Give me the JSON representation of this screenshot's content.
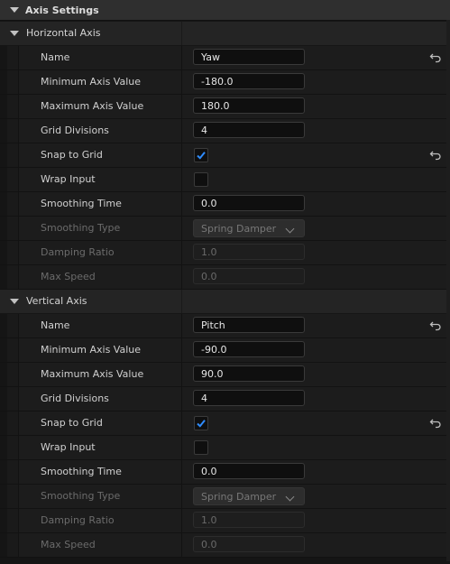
{
  "category": {
    "title": "Axis Settings"
  },
  "sections": [
    {
      "title": "Horizontal Axis",
      "rows": [
        {
          "label": "Name",
          "type": "text",
          "value": "Yaw",
          "reset": true,
          "disabled": false
        },
        {
          "label": "Minimum Axis Value",
          "type": "text",
          "value": "-180.0",
          "reset": false,
          "disabled": false
        },
        {
          "label": "Maximum Axis Value",
          "type": "text",
          "value": "180.0",
          "reset": false,
          "disabled": false
        },
        {
          "label": "Grid Divisions",
          "type": "text",
          "value": "4",
          "reset": false,
          "disabled": false
        },
        {
          "label": "Snap to Grid",
          "type": "checkbox",
          "checked": true,
          "reset": true,
          "disabled": false
        },
        {
          "label": "Wrap Input",
          "type": "checkbox",
          "checked": false,
          "reset": false,
          "disabled": false
        },
        {
          "label": "Smoothing Time",
          "type": "text",
          "value": "0.0",
          "reset": false,
          "disabled": false
        },
        {
          "label": "Smoothing Type",
          "type": "dropdown",
          "value": "Spring Damper",
          "reset": false,
          "disabled": true
        },
        {
          "label": "Damping Ratio",
          "type": "text",
          "value": "1.0",
          "reset": false,
          "disabled": true
        },
        {
          "label": "Max Speed",
          "type": "text",
          "value": "0.0",
          "reset": false,
          "disabled": true
        }
      ]
    },
    {
      "title": "Vertical Axis",
      "rows": [
        {
          "label": "Name",
          "type": "text",
          "value": "Pitch",
          "reset": true,
          "disabled": false
        },
        {
          "label": "Minimum Axis Value",
          "type": "text",
          "value": "-90.0",
          "reset": false,
          "disabled": false
        },
        {
          "label": "Maximum Axis Value",
          "type": "text",
          "value": "90.0",
          "reset": false,
          "disabled": false
        },
        {
          "label": "Grid Divisions",
          "type": "text",
          "value": "4",
          "reset": false,
          "disabled": false
        },
        {
          "label": "Snap to Grid",
          "type": "checkbox",
          "checked": true,
          "reset": true,
          "disabled": false
        },
        {
          "label": "Wrap Input",
          "type": "checkbox",
          "checked": false,
          "reset": false,
          "disabled": false
        },
        {
          "label": "Smoothing Time",
          "type": "text",
          "value": "0.0",
          "reset": false,
          "disabled": false
        },
        {
          "label": "Smoothing Type",
          "type": "dropdown",
          "value": "Spring Damper",
          "reset": false,
          "disabled": true
        },
        {
          "label": "Damping Ratio",
          "type": "text",
          "value": "1.0",
          "reset": false,
          "disabled": true
        },
        {
          "label": "Max Speed",
          "type": "text",
          "value": "0.0",
          "reset": false,
          "disabled": true
        }
      ]
    }
  ],
  "colors": {
    "accent": "#2f8cff",
    "panel": "#1c1c1c",
    "header": "#2f2f2f"
  }
}
